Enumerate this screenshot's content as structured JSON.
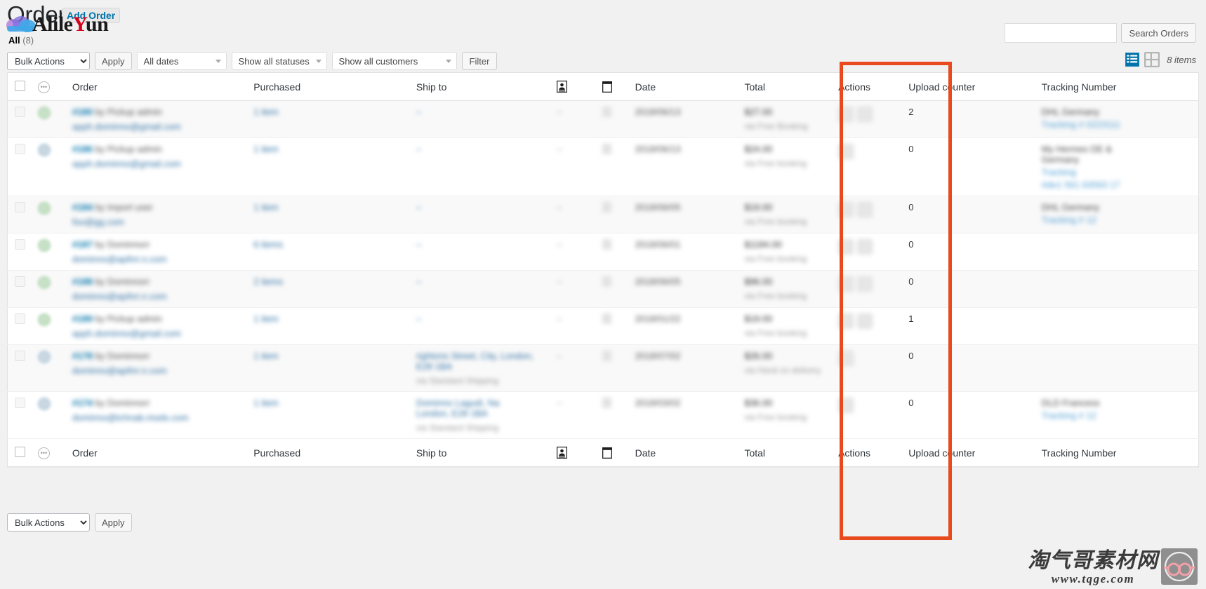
{
  "header": {
    "title": "Orders",
    "add_order_label": "Add Order",
    "watermark_logo": "AlileYun",
    "watermark_logo_pre": "Alile",
    "watermark_logo_accent": "Y",
    "watermark_logo_post": "un"
  },
  "search": {
    "value": "",
    "placeholder": "",
    "button_label": "Search Orders"
  },
  "views": {
    "all_label": "All",
    "all_count": "(8)"
  },
  "toolbar": {
    "bulk_actions_label": "Bulk Actions",
    "bulk_actions_options": [
      "Bulk Actions"
    ],
    "apply_label": "Apply",
    "all_dates_label": "All dates",
    "all_statuses_label": "Show all statuses",
    "all_customers_label": "Show all customers",
    "filter_label": "Filter",
    "items_count": "8 items",
    "list_view_icon": "list-view-icon",
    "excerpt_view_icon": "excerpt-view-icon",
    "list_view_color": "#0073aa",
    "excerpt_view_color": "#b4b4b4"
  },
  "toolbar_bottom": {
    "bulk_actions_label": "Bulk Actions",
    "apply_label": "Apply"
  },
  "table": {
    "columns": [
      {
        "key": "cb",
        "label": "",
        "icon": "select-all-checkbox"
      },
      {
        "key": "status",
        "label": "",
        "icon": "order-status-icon"
      },
      {
        "key": "order",
        "label": "Order",
        "icon": ""
      },
      {
        "key": "purchased",
        "label": "Purchased",
        "icon": ""
      },
      {
        "key": "shipto",
        "label": "Ship to",
        "icon": ""
      },
      {
        "key": "billing",
        "label": "",
        "icon": "person-icon"
      },
      {
        "key": "note",
        "label": "",
        "icon": "note-icon"
      },
      {
        "key": "date",
        "label": "Date",
        "icon": ""
      },
      {
        "key": "total",
        "label": "Total",
        "icon": ""
      },
      {
        "key": "actions",
        "label": "Actions",
        "icon": ""
      },
      {
        "key": "upload",
        "label": "Upload counter",
        "icon": ""
      },
      {
        "key": "tracking",
        "label": "Tracking Number",
        "icon": ""
      }
    ],
    "rows": [
      {
        "status_color": "green",
        "order_id": "#180",
        "order_by": "by Pickup admin",
        "order_email": "apph.dominno@gmail.com",
        "purchased": "1 item",
        "ship_to": "–",
        "ship_sub": "",
        "billing": "–",
        "date": "2018/06/13",
        "total": "$27.00",
        "total_sub": "via Free Booking",
        "actions": [
          "complete-order-icon",
          "view-order-icon"
        ],
        "upload": "2",
        "tracking_carrier": "DHL Germany",
        "tracking_link": "Tracking # 0223111",
        "tracking_link2": ""
      },
      {
        "status_color": "blue",
        "order_id": "#186",
        "order_by": "by Pickup admin",
        "order_email": "apph.dominno@gmail.com",
        "purchased": "1 item",
        "ship_to": "–",
        "ship_sub": "",
        "billing": "–",
        "date": "2018/06/13",
        "total": "$24.00",
        "total_sub": "via Free booking",
        "actions": [
          "view-order-icon"
        ],
        "upload": "0",
        "tracking_carrier": "My Hermes DE &",
        "tracking_carrier2": "Germany",
        "tracking_link": "Tracking",
        "tracking_link2": "#de1 561 63563 17"
      },
      {
        "status_color": "green",
        "order_id": "#184",
        "order_by": "by import user",
        "order_email": "foo@gg.com",
        "purchased": "1 item",
        "ship_to": "–",
        "ship_sub": "",
        "billing": "–",
        "date": "2018/06/05",
        "total": "$19.00",
        "total_sub": "via Free booking",
        "actions": [
          "complete-order-icon",
          "view-order-icon"
        ],
        "upload": "0",
        "tracking_carrier": "DHL Germany",
        "tracking_link": "Tracking # 12",
        "tracking_link2": ""
      },
      {
        "status_color": "green",
        "order_id": "#187",
        "order_by": "by Dominnorr",
        "order_email": "dominno@apihrr.n.com",
        "purchased": "6 items",
        "ship_to": "–",
        "ship_sub": "",
        "billing": "–",
        "date": "2018/06/01",
        "total": "$1184.00",
        "total_sub": "via Free booking",
        "actions": [
          "complete-order-icon",
          "view-order-icon"
        ],
        "upload": "0",
        "tracking_carrier": "",
        "tracking_link": "",
        "tracking_link2": ""
      },
      {
        "status_color": "green",
        "order_id": "#188",
        "order_by": "by Dominnorr",
        "order_email": "dominno@apihrr.n.com",
        "purchased": "2 items",
        "ship_to": "–",
        "ship_sub": "",
        "billing": "–",
        "date": "2018/06/05",
        "total": "$96.00",
        "total_sub": "via Free booking",
        "actions": [
          "complete-order-icon",
          "view-order-icon"
        ],
        "upload": "0",
        "tracking_carrier": "",
        "tracking_link": "",
        "tracking_link2": ""
      },
      {
        "status_color": "green",
        "order_id": "#189",
        "order_by": "by Pickup admin",
        "order_email": "apph.dominno@gmail.com",
        "purchased": "1 item",
        "ship_to": "–",
        "ship_sub": "",
        "billing": "–",
        "date": "2018/01/22",
        "total": "$19.00",
        "total_sub": "via Free booking",
        "actions": [
          "complete-order-icon",
          "view-order-icon"
        ],
        "upload": "1",
        "tracking_carrier": "",
        "tracking_link": "",
        "tracking_link2": ""
      },
      {
        "status_color": "blue",
        "order_id": "#178",
        "order_by": "by Dominnorr",
        "order_email": "dominno@apihrr.n.com",
        "purchased": "1 item",
        "ship_to": "rightons Street, City, London,",
        "ship_to2": "E28 1BA",
        "ship_sub": "via Standard Shipping",
        "billing": "–",
        "date": "2018/07/02",
        "total": "$26.00",
        "total_sub": "via Hand on delivery",
        "actions": [
          "view-order-icon"
        ],
        "upload": "0",
        "tracking_carrier": "",
        "tracking_link": "",
        "tracking_link2": ""
      },
      {
        "status_color": "blue",
        "order_id": "#174",
        "order_by": "by Dominnorr",
        "order_email": "dominno@tchnab.mods.com",
        "purchased": "1 item",
        "ship_to": "Dominno Lagudi, Na",
        "ship_to2": "London, E28 1BA",
        "ship_sub": "via Standard Shipping",
        "billing": "–",
        "date": "2018/03/02",
        "total": "$36.00",
        "total_sub": "via Free booking",
        "actions": [
          "view-order-icon"
        ],
        "upload": "0",
        "tracking_carrier": "DLD Francess",
        "tracking_link": "Tracking # 12",
        "tracking_link2": ""
      }
    ]
  },
  "highlight": {
    "color": "#e8491d",
    "target_column": "Upload counter"
  },
  "watermark": {
    "cn_text": "淘气哥素材网",
    "url_text": "www.tqge.com",
    "badge_icon": "glasses-logo-icon"
  }
}
